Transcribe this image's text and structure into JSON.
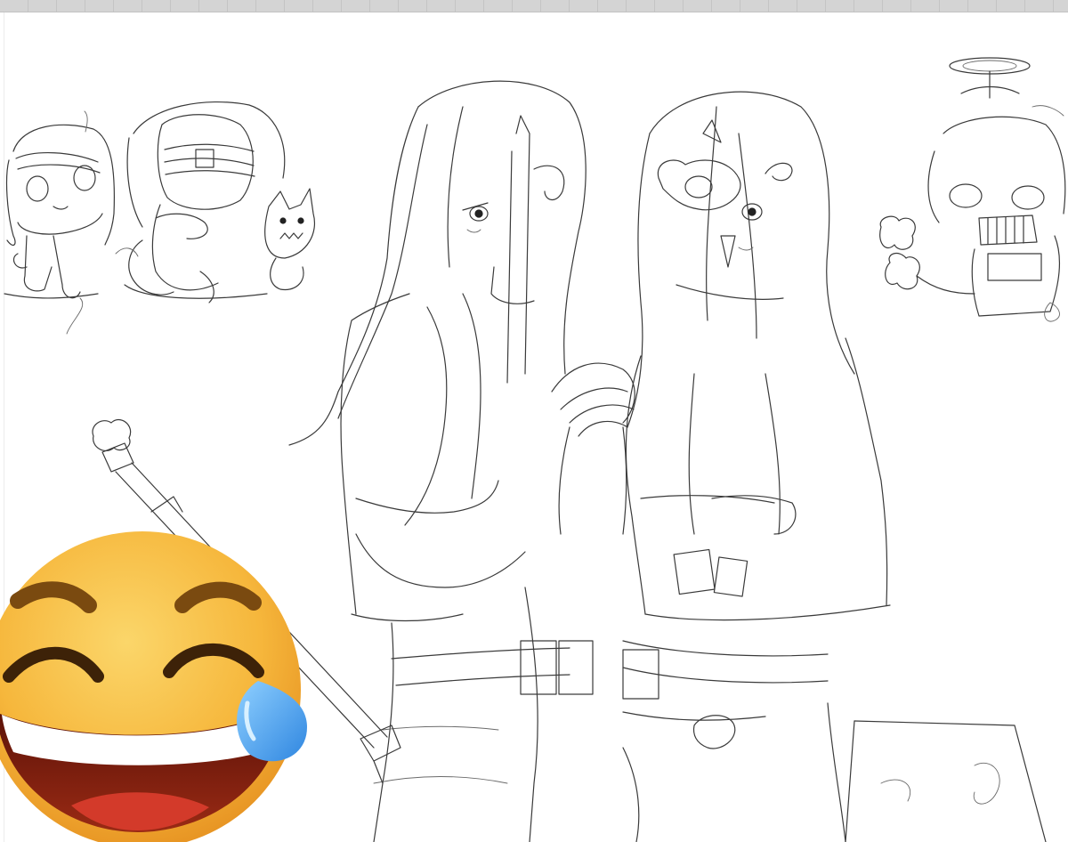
{
  "canvas": {
    "background": "#ffffff",
    "ruler_color": "#d4d4d4",
    "line_color": "#3a3a3a"
  },
  "artwork": {
    "subject_icons": [
      "chibi-girl-sketch-icon",
      "chibi-hooded-figure-sketch-icon",
      "cat-creature-sketch-icon",
      "two-long-haired-girls-sketch-icon",
      "propeller-hat-chibi-sketch-icon",
      "sword-sketch-icon"
    ]
  },
  "sticker": {
    "icon": "face-with-tears-of-joy-icon",
    "face_color": "#f6b73c",
    "tear_color": "#3f9be8"
  }
}
